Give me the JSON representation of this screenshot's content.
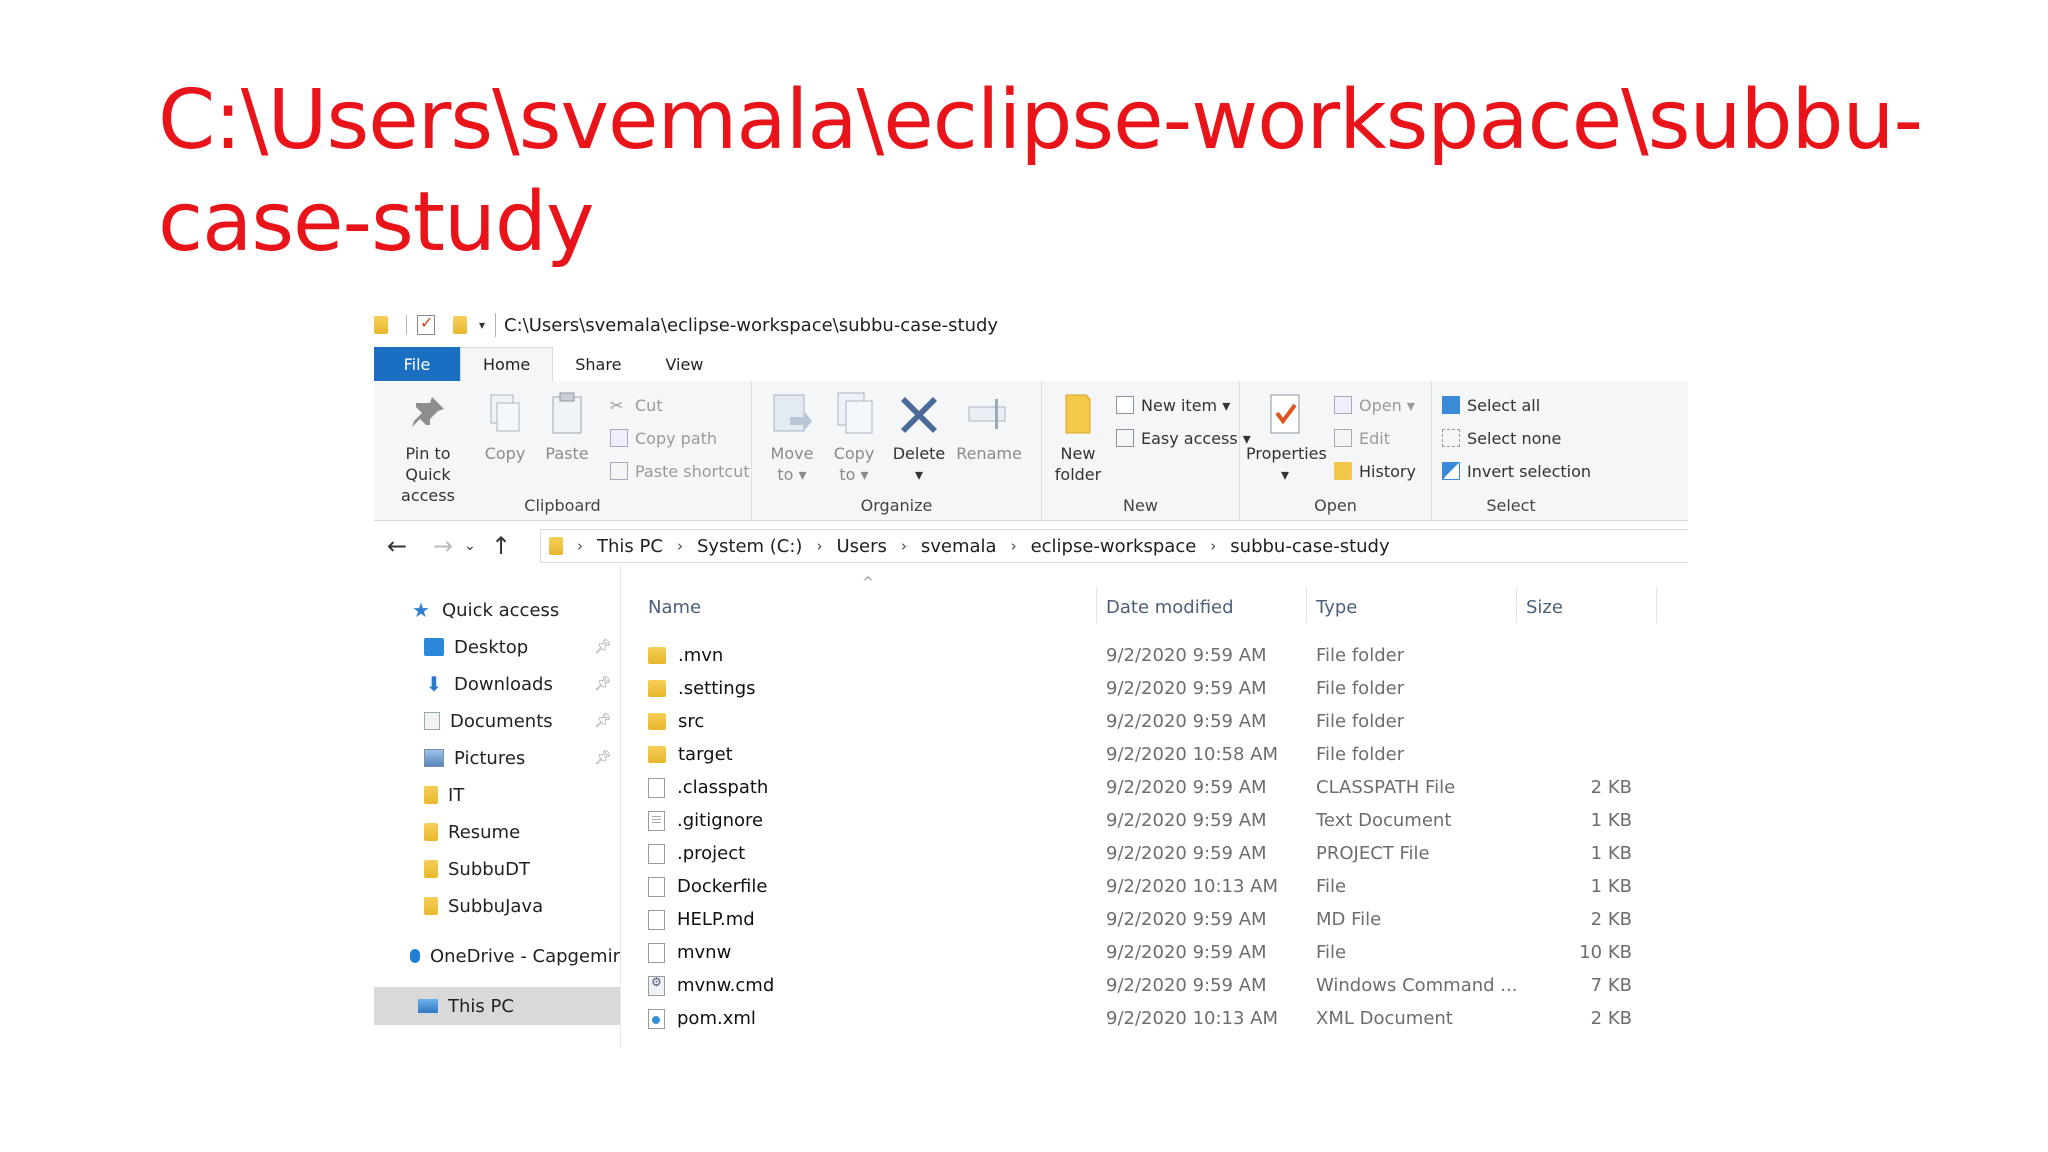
{
  "slide": {
    "title_line1": "C:\\Users\\svemala\\eclipse-workspace\\subbu-",
    "title_line2": "case-study",
    "title_color": "#e8141a"
  },
  "window": {
    "title": "C:\\Users\\svemala\\eclipse-workspace\\subbu-case-study",
    "tabs": [
      "File",
      "Home",
      "Share",
      "View"
    ],
    "active_tab": "Home",
    "accent": "#1a6fc2"
  },
  "ribbon": {
    "clipboard": {
      "label": "Clipboard",
      "pin_line1": "Pin to Quick",
      "pin_line2": "access",
      "copy": "Copy",
      "paste": "Paste",
      "cut": "Cut",
      "copy_path": "Copy path",
      "paste_shortcut": "Paste shortcut"
    },
    "organize": {
      "label": "Organize",
      "move_line1": "Move",
      "move_line2": "to ▾",
      "copyto_line1": "Copy",
      "copyto_line2": "to ▾",
      "delete_line1": "Delete",
      "delete_line2": "▾",
      "rename": "Rename"
    },
    "new": {
      "label": "New",
      "folder_line1": "New",
      "folder_line2": "folder",
      "new_item": "New item ▾",
      "easy_access": "Easy access ▾"
    },
    "open": {
      "label": "Open",
      "properties_line1": "Properties",
      "properties_line2": "▾",
      "open": "Open ▾",
      "edit": "Edit",
      "history": "History"
    },
    "select": {
      "label": "Select",
      "select_all": "Select all",
      "select_none": "Select none",
      "invert": "Invert selection"
    }
  },
  "address": {
    "crumbs": [
      "This PC",
      "System (C:)",
      "Users",
      "svemala",
      "eclipse-workspace",
      "subbu-case-study"
    ]
  },
  "nav": {
    "quick_access": "Quick access",
    "items": [
      {
        "label": "Desktop",
        "icon": "desktop-icon",
        "pinned": true
      },
      {
        "label": "Downloads",
        "icon": "downloads-icon",
        "pinned": true
      },
      {
        "label": "Documents",
        "icon": "documents-icon",
        "pinned": true
      },
      {
        "label": "Pictures",
        "icon": "pictures-icon",
        "pinned": true
      },
      {
        "label": "IT",
        "icon": "folder-icon",
        "pinned": false
      },
      {
        "label": "Resume",
        "icon": "folder-icon",
        "pinned": false
      },
      {
        "label": "SubbuDT",
        "icon": "folder-icon",
        "pinned": false
      },
      {
        "label": "SubbuJava",
        "icon": "folder-icon",
        "pinned": false
      }
    ],
    "onedrive": "OneDrive - Capgemir",
    "this_pc": "This PC"
  },
  "files": {
    "columns": {
      "name": "Name",
      "date": "Date modified",
      "type": "Type",
      "size": "Size"
    },
    "rows": [
      {
        "name": ".mvn",
        "date": "9/2/2020 9:59 AM",
        "type": "File folder",
        "size": "",
        "kind": "folder"
      },
      {
        "name": ".settings",
        "date": "9/2/2020 9:59 AM",
        "type": "File folder",
        "size": "",
        "kind": "folder"
      },
      {
        "name": "src",
        "date": "9/2/2020 9:59 AM",
        "type": "File folder",
        "size": "",
        "kind": "folder"
      },
      {
        "name": "target",
        "date": "9/2/2020 10:58 AM",
        "type": "File folder",
        "size": "",
        "kind": "folder"
      },
      {
        "name": ".classpath",
        "date": "9/2/2020 9:59 AM",
        "type": "CLASSPATH File",
        "size": "2 KB",
        "kind": "doc"
      },
      {
        "name": ".gitignore",
        "date": "9/2/2020 9:59 AM",
        "type": "Text Document",
        "size": "1 KB",
        "kind": "text"
      },
      {
        "name": ".project",
        "date": "9/2/2020 9:59 AM",
        "type": "PROJECT File",
        "size": "1 KB",
        "kind": "doc"
      },
      {
        "name": "Dockerfile",
        "date": "9/2/2020 10:13 AM",
        "type": "File",
        "size": "1 KB",
        "kind": "doc"
      },
      {
        "name": "HELP.md",
        "date": "9/2/2020 9:59 AM",
        "type": "MD File",
        "size": "2 KB",
        "kind": "doc"
      },
      {
        "name": "mvnw",
        "date": "9/2/2020 9:59 AM",
        "type": "File",
        "size": "10 KB",
        "kind": "doc"
      },
      {
        "name": "mvnw.cmd",
        "date": "9/2/2020 9:59 AM",
        "type": "Windows Command ...",
        "size": "7 KB",
        "kind": "cmd"
      },
      {
        "name": "pom.xml",
        "date": "9/2/2020 10:13 AM",
        "type": "XML Document",
        "size": "2 KB",
        "kind": "xml"
      }
    ]
  }
}
